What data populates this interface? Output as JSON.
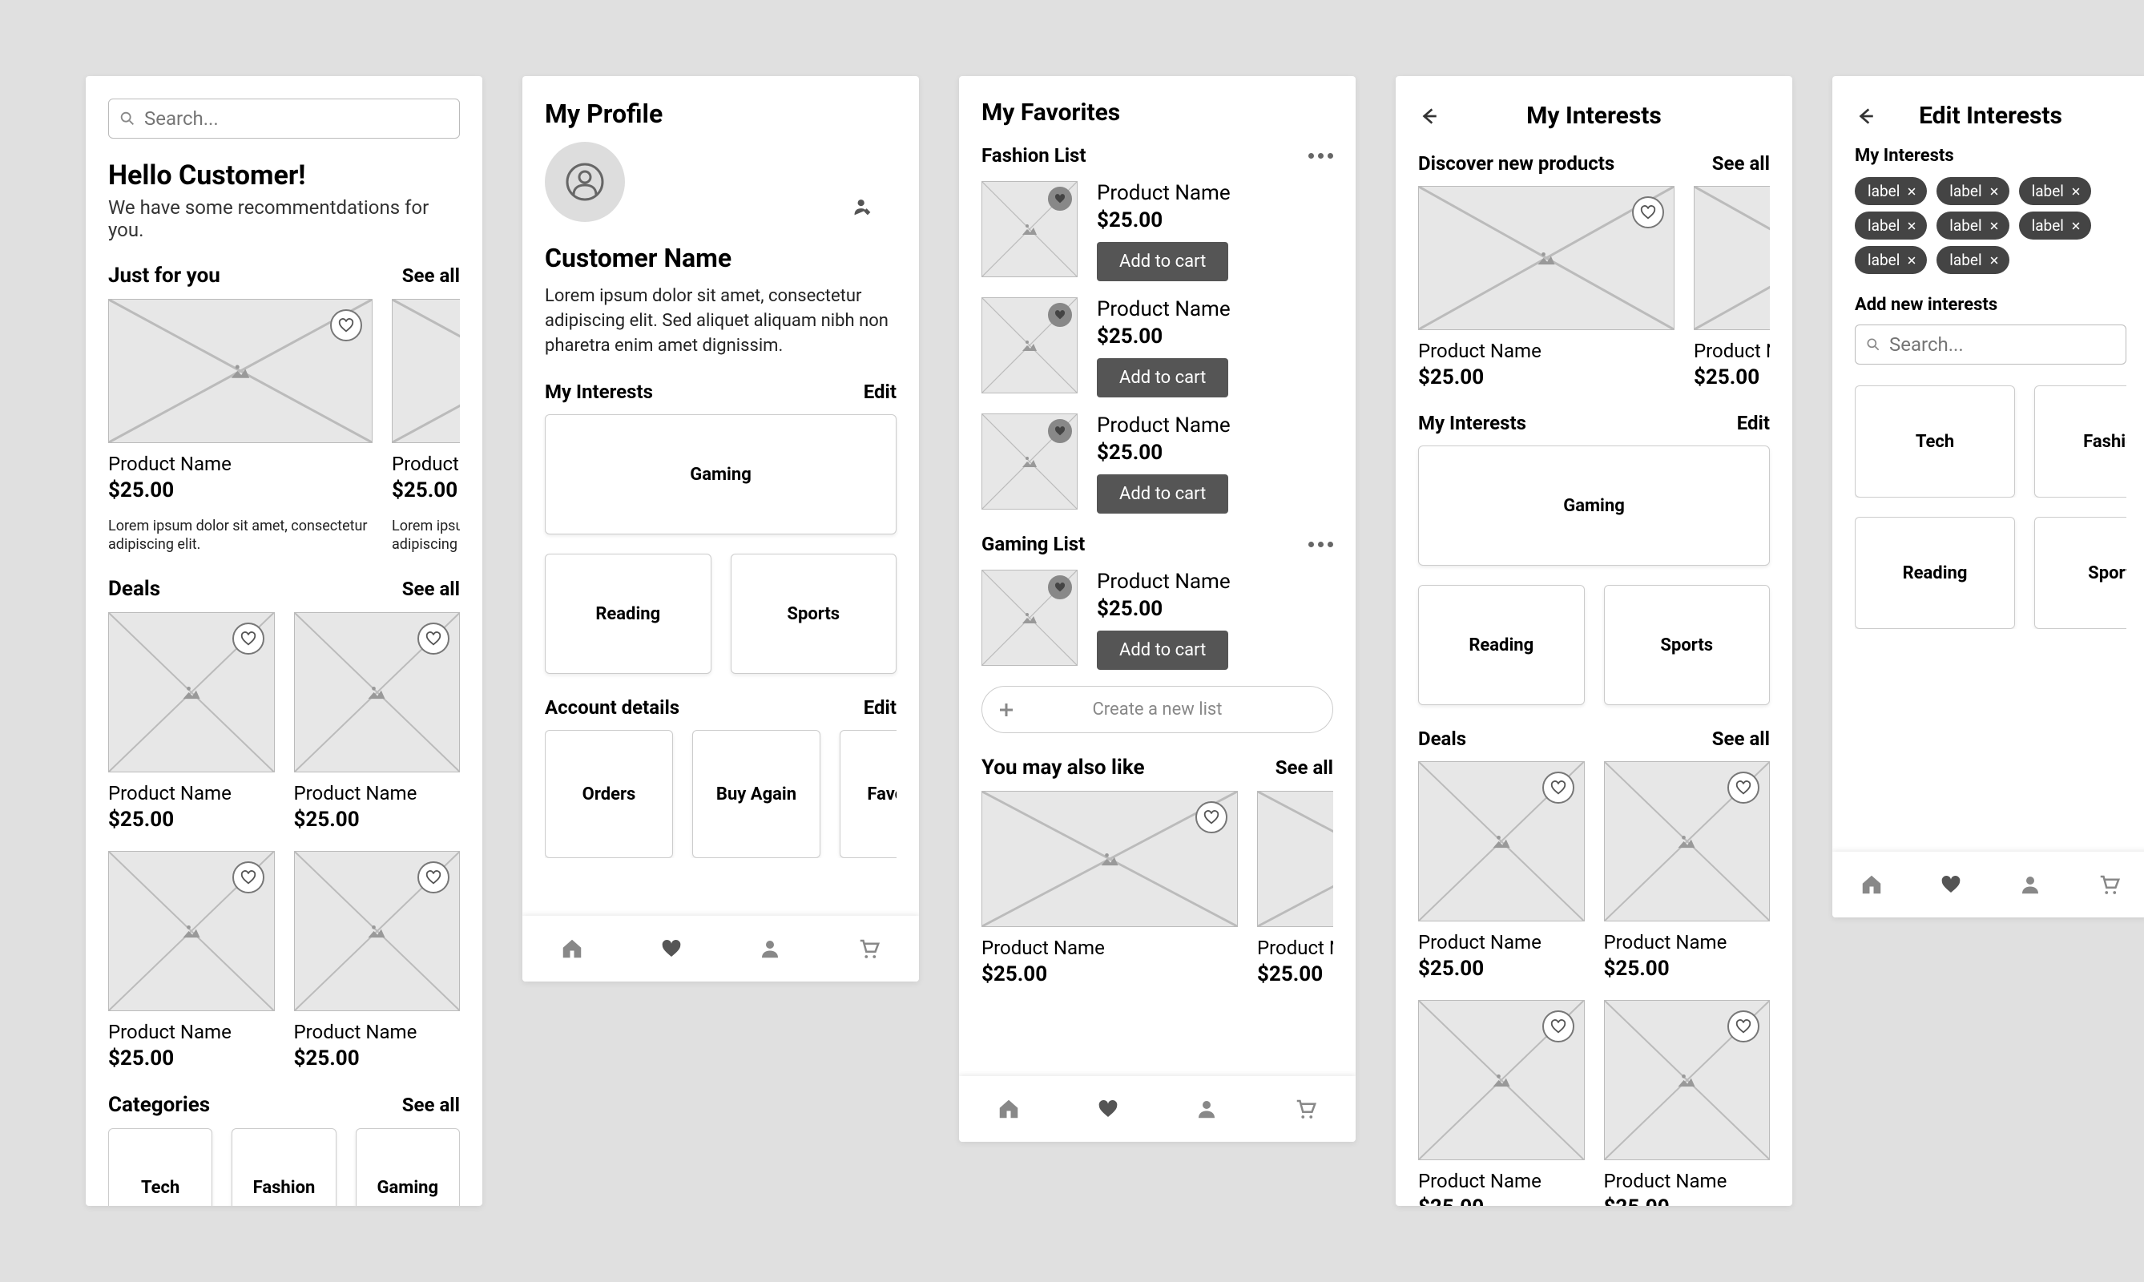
{
  "screen1": {
    "search_placeholder": "Search...",
    "greeting": "Hello Customer!",
    "subgreeting": "We have some recommentdations for you.",
    "just_for_you": "Just for you",
    "see_all": "See all",
    "deals": "Deals",
    "categories": "Categories",
    "pname": "Product Name",
    "pprice": "$25.00",
    "pdesc": "Lorem ipsum dolor sit amet, consectetur adipiscing elit.",
    "pdesc2": "Lorem ipsum dolor sit amet, consectetur adipiscing elit.",
    "cats": {
      "tech": "Tech",
      "fashion": "Fashion",
      "gaming": "Gaming"
    }
  },
  "screen2": {
    "title": "My Profile",
    "name": "Customer Name",
    "bio": "Lorem ipsum dolor sit amet, consectetur adipiscing elit. Sed aliquet aliquam nibh non pharetra enim amet dignissim.",
    "my_interests": "My Interests",
    "edit": "Edit",
    "account_details": "Account details",
    "interests": {
      "gaming": "Gaming",
      "reading": "Reading",
      "sports": "Sports"
    },
    "acct": {
      "orders": "Orders",
      "buy_again": "Buy Again",
      "favorites": "Favorites"
    }
  },
  "screen3": {
    "title": "My Favorites",
    "fashion_list": "Fashion List",
    "gaming_list": "Gaming List",
    "pname": "Product Name",
    "pprice": "$25.00",
    "add_to_cart": "Add to cart",
    "create_new_list": "Create a new list",
    "ymal": "You may also like",
    "see_all": "See all"
  },
  "screen4": {
    "title": "My Interests",
    "discover": "Discover new products",
    "see_all": "See all",
    "pname": "Product Name",
    "pprice": "$25.00",
    "my_interests": "My Interests",
    "edit": "Edit",
    "deals": "Deals",
    "interests": {
      "gaming": "Gaming",
      "reading": "Reading",
      "sports": "Sports"
    }
  },
  "screen5": {
    "title": "Edit Interests",
    "my_interests": "My Interests",
    "label": "label",
    "add_new": "Add new interests",
    "search_placeholder": "Search...",
    "cats": {
      "tech": "Tech",
      "fashion": "Fashion",
      "reading": "Reading",
      "sports": "Sports"
    }
  }
}
